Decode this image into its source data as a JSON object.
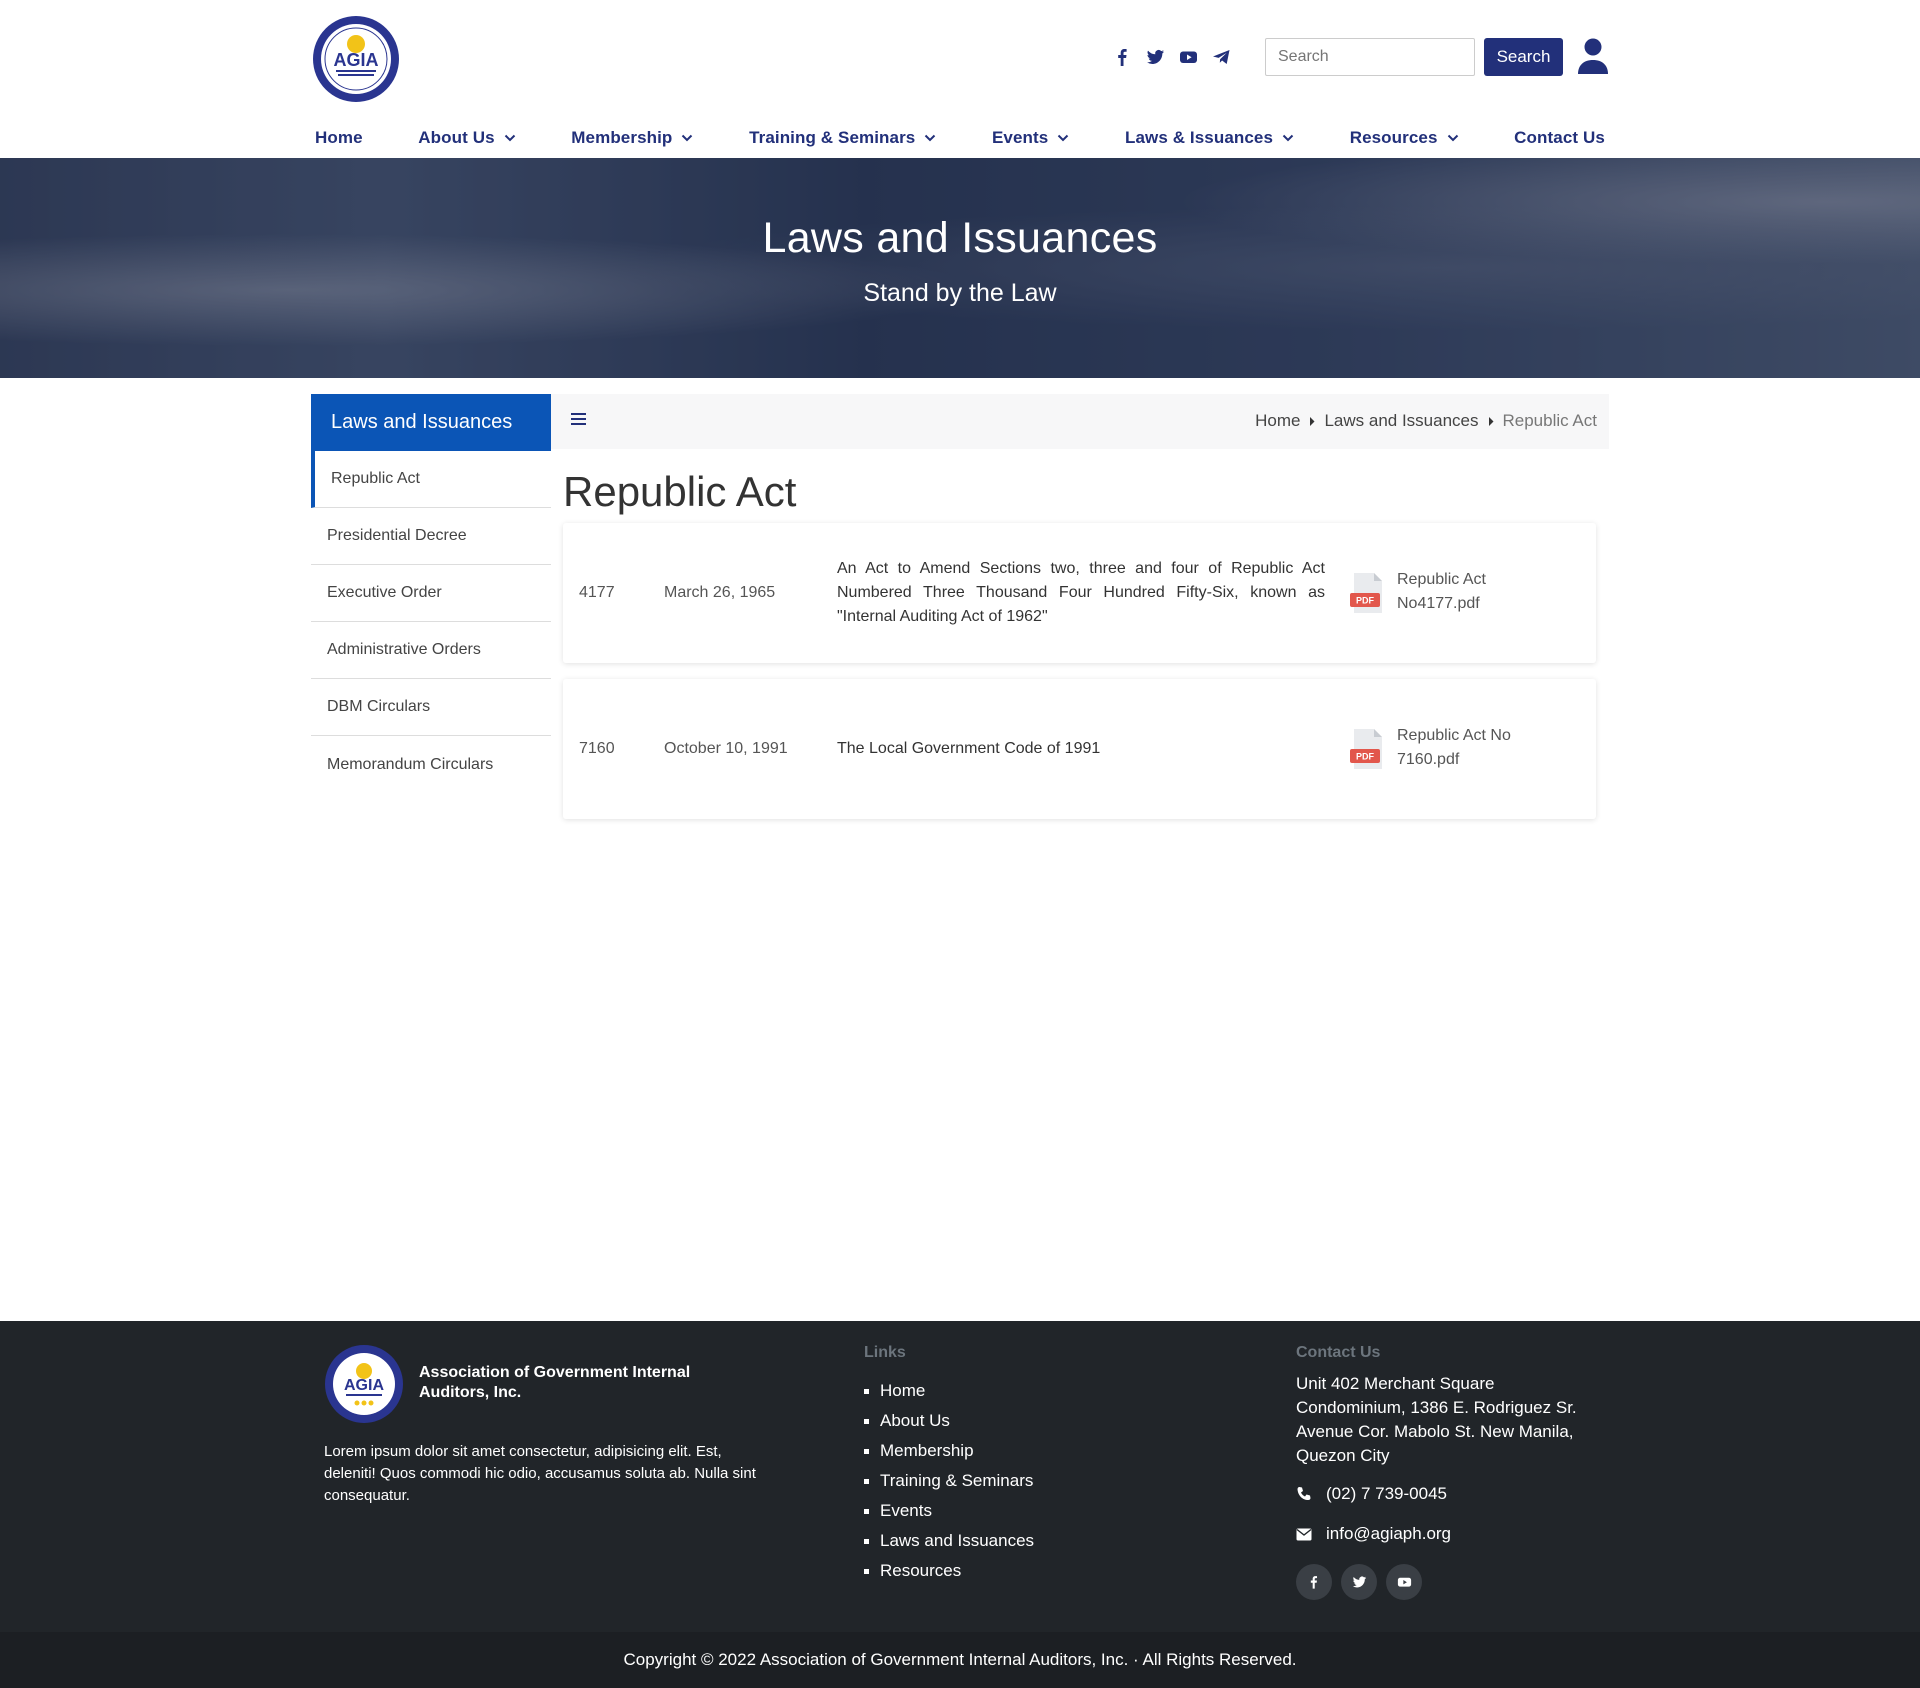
{
  "header": {
    "logo_text": "AGIA",
    "search": {
      "placeholder": "Search",
      "button_label": "Search"
    },
    "social_icons": [
      "facebook-icon",
      "twitter-icon",
      "youtube-icon",
      "telegram-icon"
    ]
  },
  "nav": {
    "items": [
      {
        "label": "Home",
        "dropdown": false
      },
      {
        "label": "About Us",
        "dropdown": true
      },
      {
        "label": "Membership",
        "dropdown": true
      },
      {
        "label": "Training & Seminars",
        "dropdown": true
      },
      {
        "label": "Events",
        "dropdown": true
      },
      {
        "label": "Laws & Issuances",
        "dropdown": true
      },
      {
        "label": "Resources",
        "dropdown": true
      },
      {
        "label": "Contact Us",
        "dropdown": false
      }
    ]
  },
  "hero": {
    "title": "Laws and Issuances",
    "subtitle": "Stand by the Law"
  },
  "sidebar": {
    "heading": "Laws and Issuances",
    "items": [
      {
        "label": "Republic Act",
        "active": true
      },
      {
        "label": "Presidential Decree",
        "active": false
      },
      {
        "label": "Executive Order",
        "active": false
      },
      {
        "label": "Administrative Orders",
        "active": false
      },
      {
        "label": "DBM Circulars",
        "active": false
      },
      {
        "label": "Memorandum Circulars",
        "active": false
      }
    ]
  },
  "breadcrumb": [
    "Home",
    "Laws and Issuances",
    "Republic Act"
  ],
  "page_title": "Republic Act",
  "documents": [
    {
      "number": "4177",
      "date": "March 26, 1965",
      "description": "An Act to Amend Sections two, three and four of Republic Act Numbered Three Thousand Four Hundred Fifty-Six, known as \"Internal Auditing Act of 1962\"",
      "file_line1": "Republic Act",
      "file_line2": "No4177.pdf"
    },
    {
      "number": "7160",
      "date": "October 10, 1991",
      "description": "The Local Government Code of 1991",
      "file_line1": "Republic Act No",
      "file_line2": "7160.pdf"
    }
  ],
  "footer": {
    "org_name": "Association of Government Internal Auditors, Inc.",
    "about": "Lorem ipsum dolor sit amet consectetur, adipisicing elit. Est, deleniti! Quos commodi hic odio, accusamus soluta ab. Nulla sint consequatur.",
    "links_title": "Links",
    "links": [
      "Home",
      "About Us",
      "Membership",
      "Training & Seminars",
      "Events",
      "Laws and Issuances",
      "Resources"
    ],
    "contact_title": "Contact Us",
    "address": "Unit 402 Merchant Square Condominium, 1386 E. Rodriguez Sr. Avenue Cor. Mabolo St. New Manila, Quezon City",
    "phone": "(02) 7 739-0045",
    "email": "info@agiaph.org",
    "copyright": "Copyright © 2022 Association of Government Internal Auditors, Inc. · All Rights Reserved."
  },
  "colors": {
    "brand_navy": "#22307a",
    "sidebar_blue": "#0b55b6",
    "footer_bg": "#212529",
    "pdf_red": "#e2574c"
  }
}
